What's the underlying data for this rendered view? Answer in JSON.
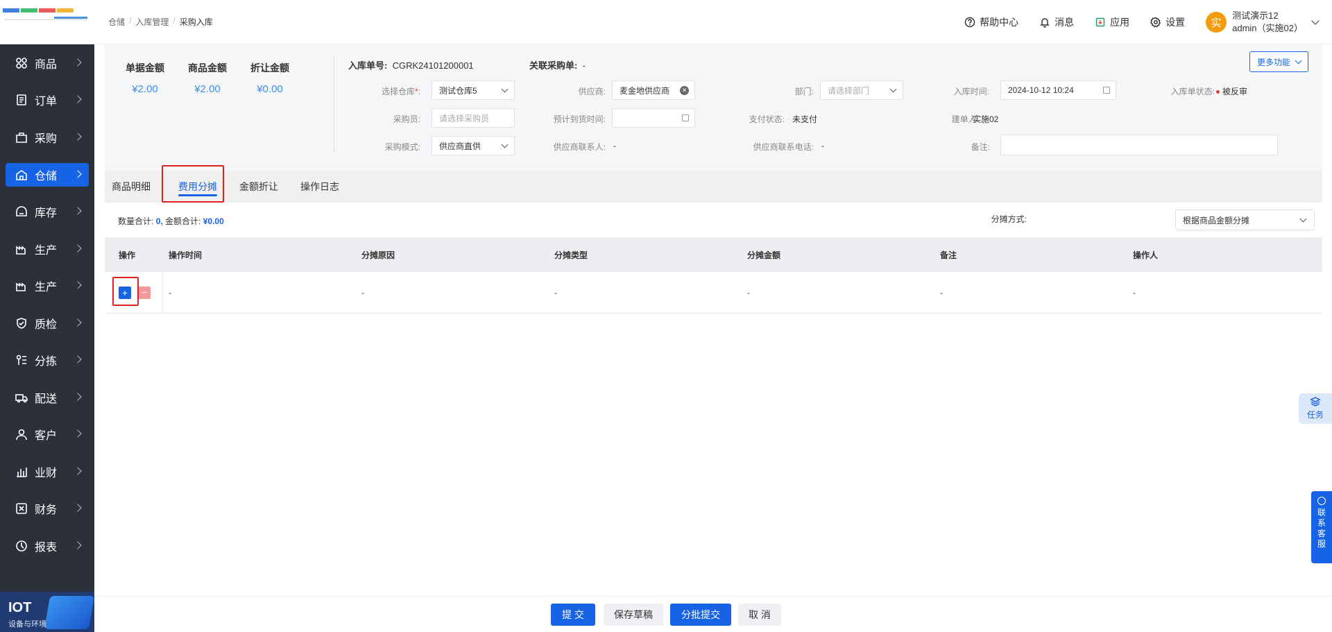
{
  "sidebar": {
    "items": [
      {
        "label": "商品"
      },
      {
        "label": "订单"
      },
      {
        "label": "采购"
      },
      {
        "label": "仓储"
      },
      {
        "label": "库存"
      },
      {
        "label": "生产"
      },
      {
        "label": "生产"
      },
      {
        "label": "质检"
      },
      {
        "label": "分拣"
      },
      {
        "label": "配送"
      },
      {
        "label": "客户"
      },
      {
        "label": "业财"
      },
      {
        "label": "财务"
      },
      {
        "label": "报表"
      }
    ],
    "logo_title": "IOT",
    "logo_sub": "设备与环境"
  },
  "header": {
    "breadcrumb": [
      "仓储",
      "入库管理",
      "采购入库"
    ],
    "help": "帮助中心",
    "messages": "消息",
    "apps": "应用",
    "settings": "设置",
    "avatar_char": "实",
    "user_name": "测试演示12",
    "user_account": "admin（实施02）"
  },
  "summary": {
    "doc_amount_label": "单据金额",
    "doc_amount": "¥2.00",
    "goods_amount_label": "商品金额",
    "goods_amount": "¥2.00",
    "discount_amount_label": "折让金额",
    "discount_amount": "¥0.00"
  },
  "form": {
    "order_no_label": "入库单号:",
    "order_no": "CGRK24101200001",
    "related_po_label": "关联采购单:",
    "related_po": "-",
    "warehouse_label": "选择仓库",
    "warehouse": "测试仓库5",
    "supplier_label": "供应商:",
    "supplier": "麦金地供应商",
    "dept_label": "部门:",
    "dept_placeholder": "请选择部门",
    "in_time_label": "入库时间:",
    "in_time": "2024-10-12 10:24",
    "status_label": "入库单状态:",
    "status": "被反审",
    "buyer_label": "采购员:",
    "buyer_placeholder": "请选择采购员",
    "eta_label": "预计到货时间:",
    "pay_status_label": "支付状态:",
    "pay_status": "未支付",
    "creator_label": "建单人:",
    "creator": "实施02",
    "mode_label": "采购模式:",
    "mode": "供应商直供",
    "contact_label": "供应商联系人:",
    "contact": "-",
    "phone_label": "供应商联系电话:",
    "phone": "-",
    "remark_label": "备注:",
    "more_btn": "更多功能"
  },
  "tabs": [
    "商品明细",
    "费用分摊",
    "金额折让",
    "操作日志"
  ],
  "totals": {
    "qty_label": "数量合计:",
    "qty": "0,",
    "amt_label": "金额合计:",
    "amt": "¥0.00"
  },
  "method": {
    "label": "分摊方式:",
    "value": "根据商品金额分摊"
  },
  "table": {
    "headers": [
      "操作",
      "操作时间",
      "分摊原因",
      "分摊类型",
      "分摊金额",
      "备注",
      "操作人"
    ],
    "row": [
      "-",
      "-",
      "-",
      "-",
      "-",
      "-"
    ],
    "add": "+",
    "remove": "−"
  },
  "float": {
    "task": "任务",
    "service": "联系客服"
  },
  "footer": {
    "submit": "提 交",
    "draft": "保存草稿",
    "batch": "分批提交",
    "cancel": "取 消"
  }
}
